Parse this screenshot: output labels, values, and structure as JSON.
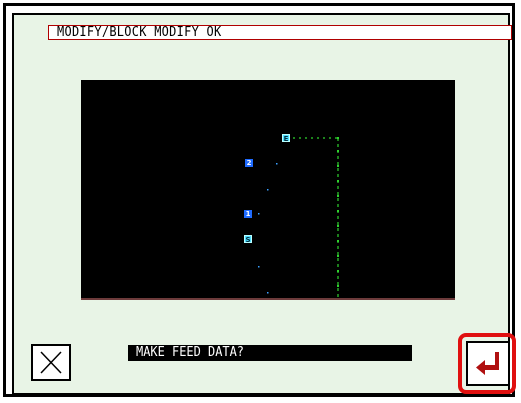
{
  "header": {
    "title": "MODIFY/BLOCK MODIFY  OK"
  },
  "canvas": {
    "background": "#000000",
    "stitch_color": "#2ed12e",
    "markers": [
      {
        "label": "E",
        "style": "cyan"
      },
      {
        "label": "2",
        "style": "blue"
      },
      {
        "label": "1",
        "style": "blue"
      },
      {
        "label": "S",
        "style": "cyan"
      }
    ]
  },
  "footer": {
    "prompt": "MAKE FEED DATA?",
    "cancel_icon": "close-x-icon",
    "enter_icon": "enter-return-icon",
    "enter_highlight_color": "#e01010",
    "enter_arrow_color": "#b01010"
  }
}
